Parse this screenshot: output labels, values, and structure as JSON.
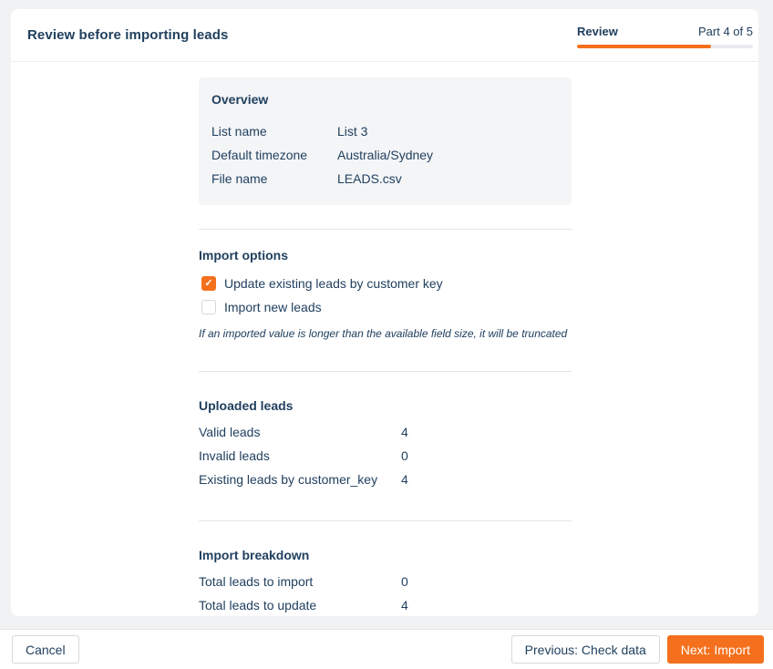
{
  "header": {
    "title": "Review before importing leads",
    "tab_label": "Review",
    "step_label": "Part 4 of 5",
    "progress_percent": 76
  },
  "overview": {
    "heading": "Overview",
    "rows": [
      {
        "label": "List name",
        "value": "List 3"
      },
      {
        "label": "Default timezone",
        "value": "Australia/Sydney"
      },
      {
        "label": "File name",
        "value": "LEADS.csv"
      }
    ]
  },
  "import_options": {
    "heading": "Import options",
    "checkboxes": [
      {
        "label": "Update existing leads by customer key",
        "checked": true
      },
      {
        "label": "Import new leads",
        "checked": false
      }
    ],
    "note": "If an imported value is longer than the available field size, it will be truncated"
  },
  "uploaded_leads": {
    "heading": "Uploaded leads",
    "rows": [
      {
        "label": "Valid leads",
        "value": "4"
      },
      {
        "label": "Invalid leads",
        "value": "0"
      },
      {
        "label": "Existing leads by customer_key",
        "value": "4"
      }
    ]
  },
  "import_breakdown": {
    "heading": "Import breakdown",
    "rows": [
      {
        "label": "Total leads to import",
        "value": "0"
      },
      {
        "label": "Total leads to update",
        "value": "4"
      }
    ]
  },
  "footer": {
    "cancel_label": "Cancel",
    "previous_label": "Previous: Check data",
    "next_label": "Next: Import"
  },
  "icons": {
    "check": "✓"
  },
  "colors": {
    "accent_orange": "#f4701d",
    "navy_text": "#21405f",
    "box_background": "#f4f5f7"
  }
}
